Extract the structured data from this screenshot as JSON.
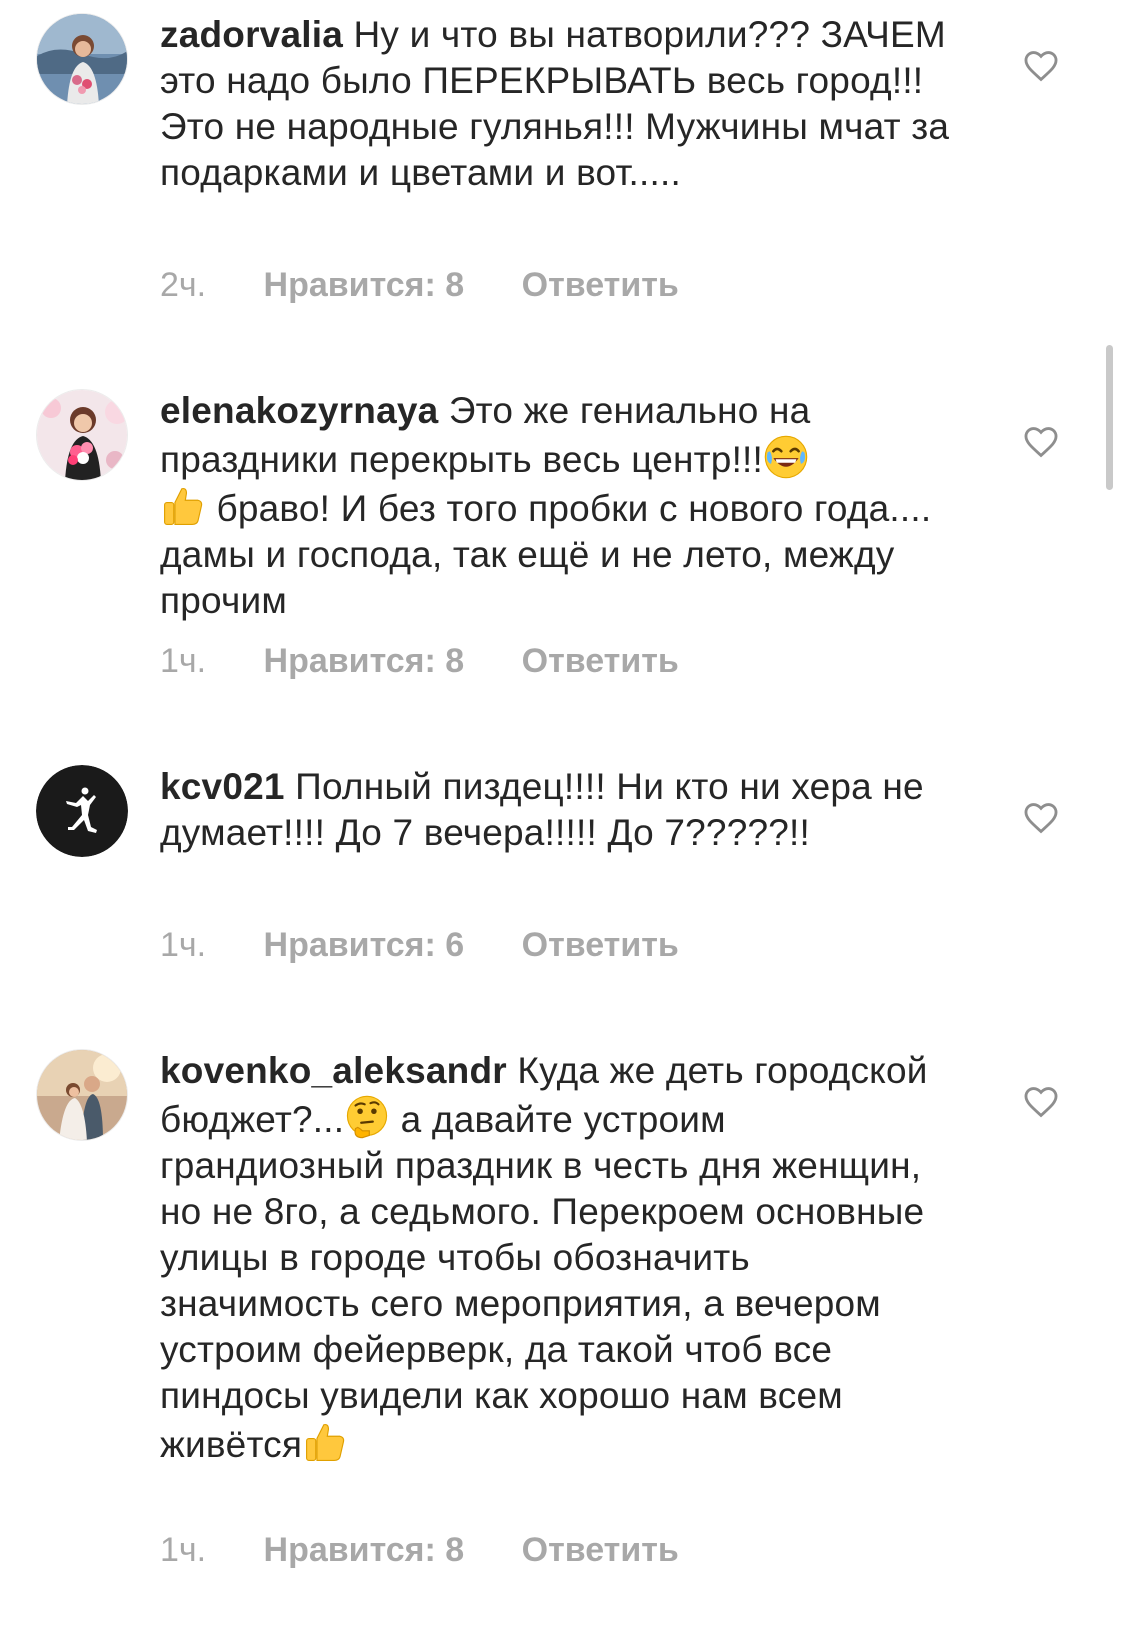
{
  "comments": [
    {
      "username": "zadorvalia",
      "text": "Ну и что вы натворили??? ЗАЧЕМ это надо было ПЕРЕКРЫВАТЬ весь город!!! Это не народные гулянья!!! Мужчины мчат за подарками и цветами и вот.....",
      "time": "2ч.",
      "likes": "Нравится: 8",
      "reply": "Ответить"
    },
    {
      "username": "elenakozyrnaya",
      "text_1": "Это же гениально на праздники перекрыть весь центр!!!",
      "text_2": " браво!  И без того пробки с нового года.... дамы и господа, так ещё и не лето, между прочим",
      "emoji_1": "laughing-emoji",
      "emoji_2": "thumbs-up-emoji",
      "time": "1ч.",
      "likes": "Нравится: 8",
      "reply": "Ответить"
    },
    {
      "username": "kcv021",
      "text": "Полный пиздец!!!! Ни кто ни хера не думает!!!! До 7 вечера!!!!! До 7?????!!",
      "time": "1ч.",
      "likes": "Нравится: 6",
      "reply": "Ответить"
    },
    {
      "username": "kovenko_aleksandr",
      "text_1": "Куда же деть городской бюджет?...",
      "text_2": " а давайте устроим грандиозный праздник в честь дня женщин, но не 8го, а седьмого. Перекроем основные улицы в городе чтобы обозначить значимость сего мероприятия, а вечером устроим фейерверк, да такой чтоб все пиндосы увидели как хорошо нам всем живётся",
      "emoji_1": "thinking-emoji",
      "emoji_2": "thumbs-up-emoji",
      "time": "1ч.",
      "likes": "Нравится: 8",
      "reply": "Ответить"
    }
  ],
  "icons": {
    "like": "heart-outline-icon",
    "avatar_3": "jumpman-logo"
  },
  "colors": {
    "text": "#262626",
    "secondary": "#a8a8a8",
    "background": "#ffffff"
  }
}
